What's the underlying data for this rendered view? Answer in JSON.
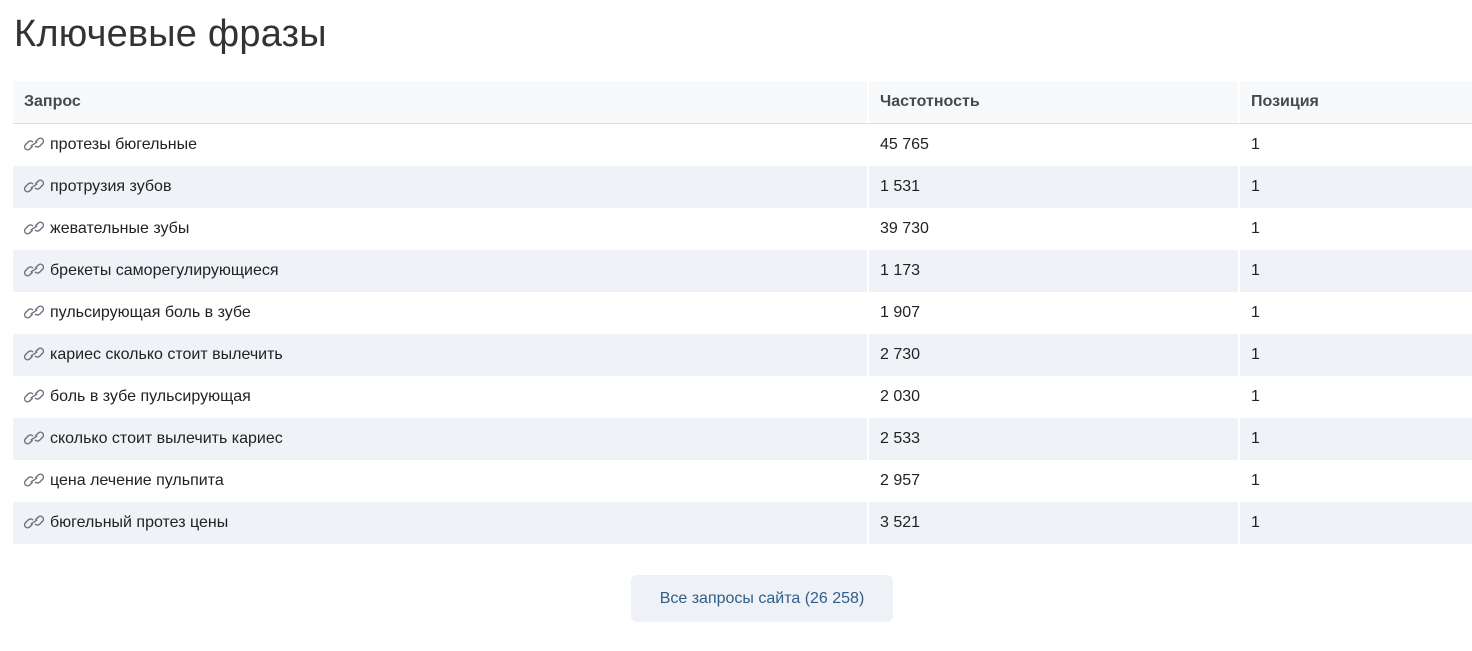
{
  "page": {
    "title": "Ключевые фразы"
  },
  "table": {
    "headers": {
      "query": "Запрос",
      "frequency": "Частотность",
      "position": "Позиция"
    },
    "rows": [
      {
        "query": "протезы бюгельные",
        "frequency": "45 765",
        "position": "1"
      },
      {
        "query": "протрузия зубов",
        "frequency": "1 531",
        "position": "1"
      },
      {
        "query": "жевательные зубы",
        "frequency": "39 730",
        "position": "1"
      },
      {
        "query": "брекеты саморегулирующиеся",
        "frequency": "1 173",
        "position": "1"
      },
      {
        "query": "пульсирующая боль в зубе",
        "frequency": "1 907",
        "position": "1"
      },
      {
        "query": "кариес сколько стоит вылечить",
        "frequency": "2 730",
        "position": "1"
      },
      {
        "query": "боль в зубе пульсирующая",
        "frequency": "2 030",
        "position": "1"
      },
      {
        "query": "сколько стоит вылечить кариес",
        "frequency": "2 533",
        "position": "1"
      },
      {
        "query": "цена лечение пульпита",
        "frequency": "2 957",
        "position": "1"
      },
      {
        "query": "бюгельный протез цены",
        "frequency": "3 521",
        "position": "1"
      }
    ]
  },
  "footer": {
    "all_queries_label": "Все запросы сайта (26 258)"
  },
  "icons": {
    "row_icon": "link-icon"
  },
  "colors": {
    "link": "#2f5f8a",
    "zebra": "#eff2f6",
    "header_bg": "#f7f9fb"
  }
}
